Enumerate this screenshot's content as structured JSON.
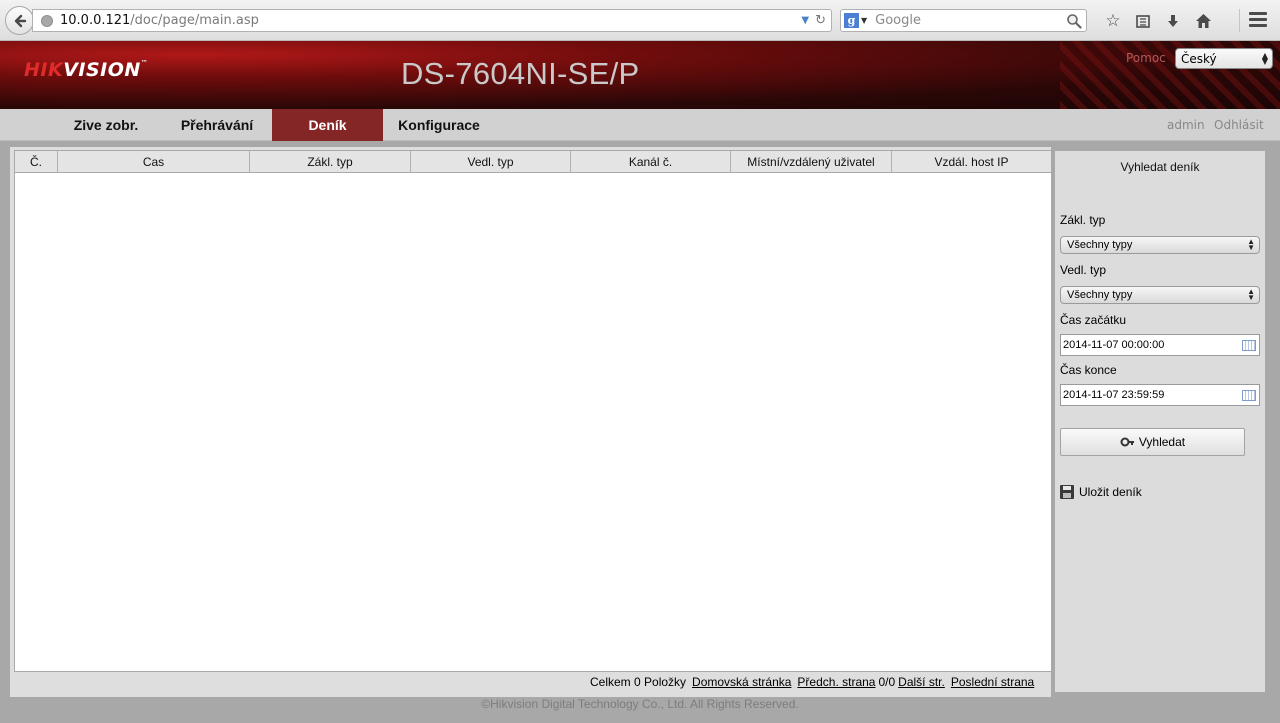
{
  "browser": {
    "url_host": "10.0.0.121",
    "url_path": "/doc/page/main.asp",
    "search_placeholder": "Google"
  },
  "header": {
    "logo_hik": "HIK",
    "logo_vision": "VISION",
    "logo_tm": "™",
    "device_title": "DS-7604NI-SE/P",
    "help_label": "Pomoc",
    "language_selected": "Český"
  },
  "nav": {
    "tabs": [
      {
        "label": "Zive zobr."
      },
      {
        "label": "Přehrávání"
      },
      {
        "label": "Deník"
      },
      {
        "label": "Konfigurace"
      }
    ],
    "active_tab": "Deník",
    "user": "admin",
    "logout": "Odhlásit"
  },
  "table": {
    "columns": [
      "Č.",
      "Cas",
      "Zákl. typ",
      "Vedl. typ",
      "Kanál č.",
      "Místní/vzdálený uživatel",
      "Vzdál. host IP"
    ],
    "rows": []
  },
  "pager": {
    "total": "Celkem 0 Položky",
    "first": "Domovská stránka",
    "prev": "Předch. strana",
    "page_info": "0/0",
    "next": "Další str.",
    "last": "Poslední strana"
  },
  "search_panel": {
    "title": "Vyhledat deník",
    "main_type_label": "Zákl. typ",
    "main_type_value": "Všechny typy",
    "sub_type_label": "Vedl. typ",
    "sub_type_value": "Všechny typy",
    "start_label": "Čas začátku",
    "start_value": "2014-11-07 00:00:00",
    "end_label": "Čas konce",
    "end_value": "2014-11-07 23:59:59",
    "search_button": "Vyhledat",
    "save_label": "Uložit deník"
  },
  "footer": "©Hikvision Digital Technology Co., Ltd. All Rights Reserved.",
  "colors": {
    "active_tab": "#842626",
    "brand_red": "#e12b2b"
  }
}
